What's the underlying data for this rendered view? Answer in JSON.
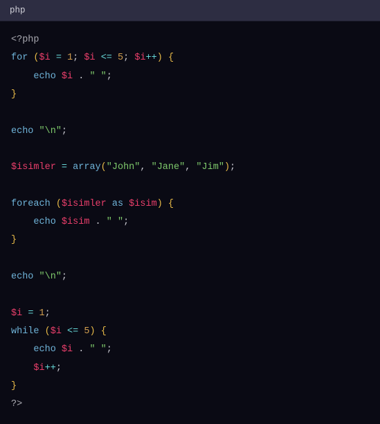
{
  "header": {
    "language": "php"
  },
  "code": {
    "t_open": "<?php",
    "t_close": "?>",
    "kw_for": "for",
    "kw_foreach": "foreach",
    "kw_while": "while",
    "kw_as": "as",
    "kw_echo": "echo",
    "fn_array": "array",
    "var_i": "$i",
    "var_isimler": "$isimler",
    "var_isim": "$isim",
    "num_1": "1",
    "num_5": "5",
    "str_space": "\" \"",
    "str_nl": "\"\\n\"",
    "str_john": "\"John\"",
    "str_jane": "\"Jane\"",
    "str_jim": "\"Jim\"",
    "op_assign": "=",
    "op_le": "<=",
    "op_inc": "++",
    "op_concat": ".",
    "p_open": "(",
    "p_close": ")",
    "b_open": "{",
    "b_close": "}",
    "semi": ";",
    "comma": ","
  }
}
